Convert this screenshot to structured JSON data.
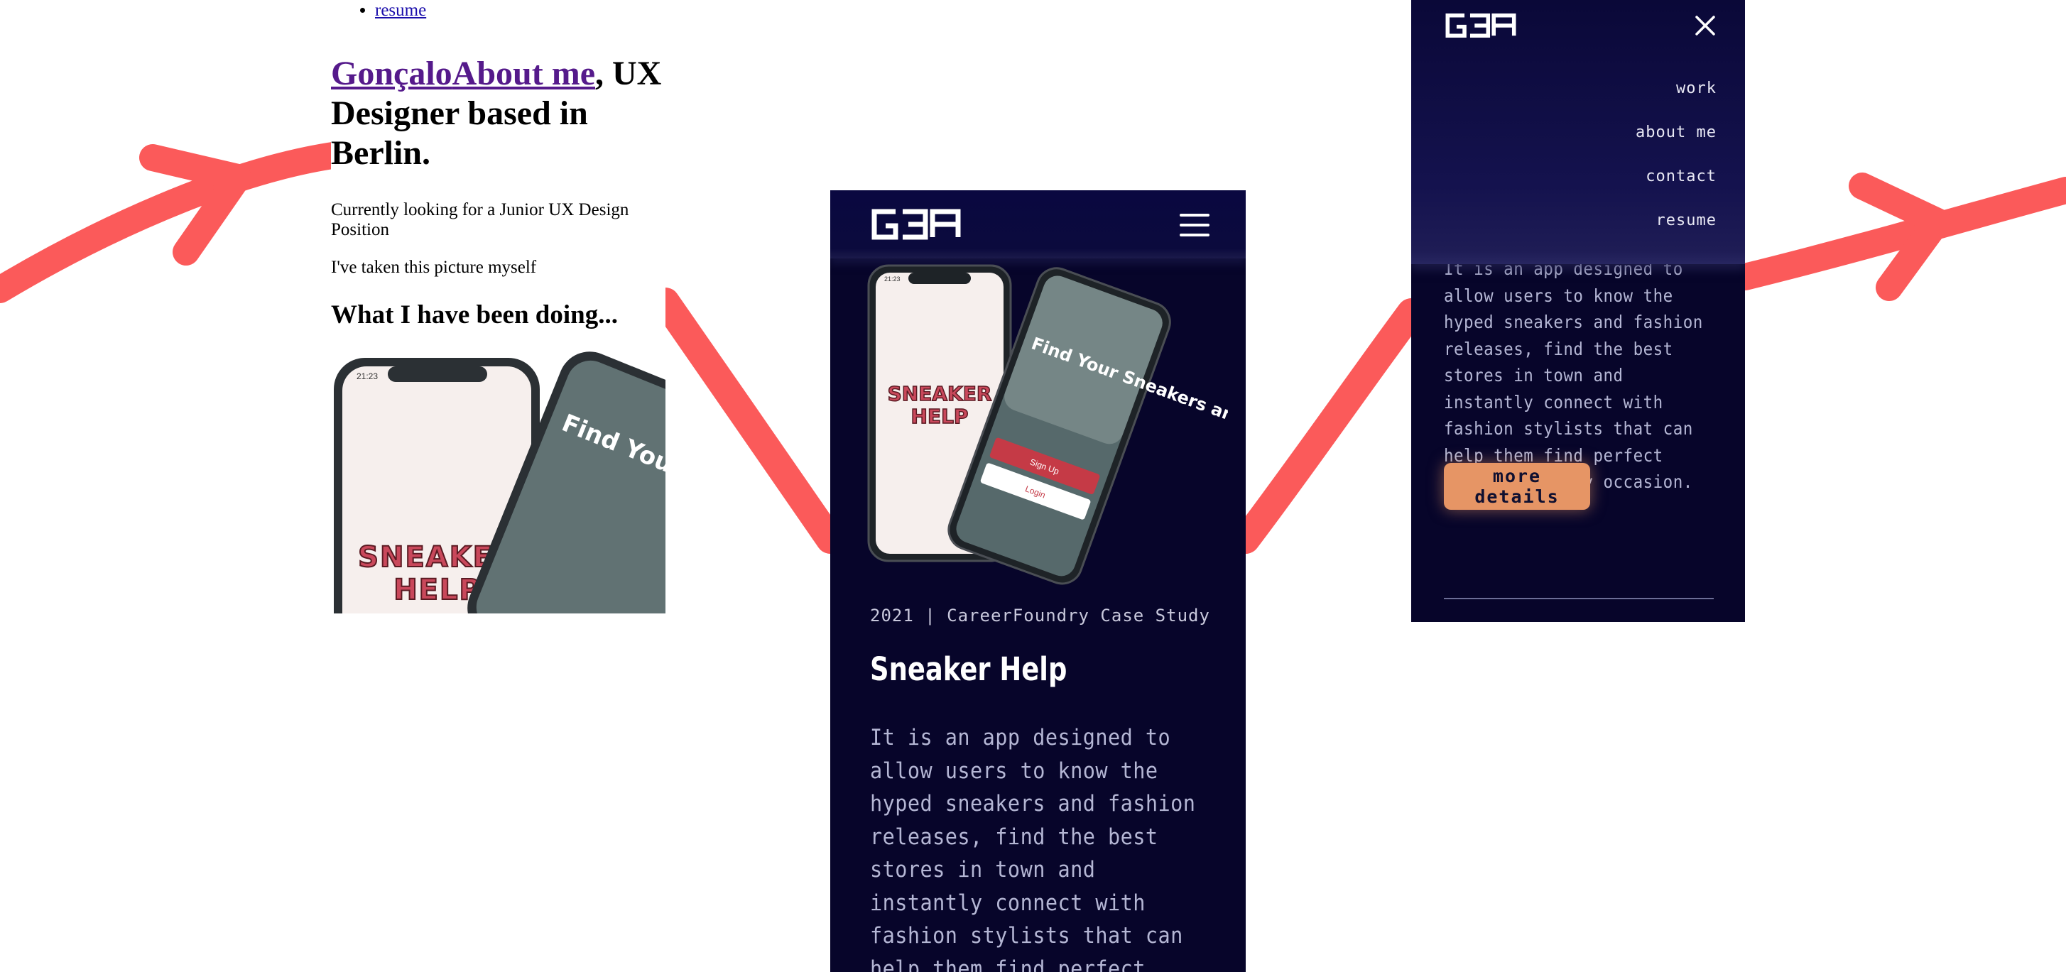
{
  "colors": {
    "arrow": "#fb5a5a",
    "site_background": "#07052a",
    "button_accent": "#e69565",
    "visited_link": "#551a8b"
  },
  "raw_page": {
    "nav_items": [
      "contact",
      "resume"
    ],
    "hero_link_name": "Gonçalo",
    "hero_link_about": "About me",
    "hero_comma": ",",
    "hero_rest": "UX Designer based in Berlin.",
    "looking": "Currently looking for a Junior UX Design Position",
    "caption": "I've taken this picture myself",
    "section_heading": "What I have been doing...",
    "app_logo_line1": "SNEAKER",
    "app_logo_line2": "HELP",
    "phone_overlay": "Find Your Sneakers and Outfits",
    "status_time": "21:23"
  },
  "site": {
    "logo_alt": "G3A",
    "menu_icon": "hamburger-icon",
    "project_meta": "2021 | CareerFoundry Case Study",
    "project_title": "Sneaker Help",
    "project_description": "It is an app designed to allow users to know the hyped sneakers and fashion releases, find the best stores in town and instantly connect with fashion stylists that can help them find perfect outfits for any occasion.",
    "phone": {
      "logo_line1": "SNEAKER",
      "logo_line2": "HELP",
      "overlay": "Find Your Sneakers and Outfits",
      "signup": "Sign Up",
      "login": "Login",
      "status_time": "21:23"
    }
  },
  "menu": {
    "close_icon": "close-icon",
    "items": [
      "work",
      "about me",
      "contact",
      "resume"
    ],
    "description": "It is an app designed to allow users to know the hyped sneakers and fashion releases, find the best stores in town and instantly connect with fashion stylists that can help them find perfect outfits for any occasion.",
    "button_label": "more details"
  }
}
